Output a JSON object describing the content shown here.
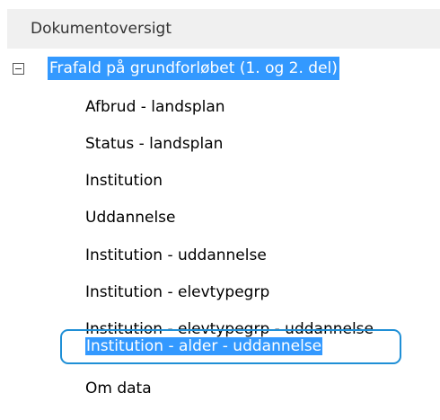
{
  "pane": {
    "title": "Dokumentoversigt"
  },
  "tree": {
    "root": {
      "label": "Frafald på grundforløbet (1. og 2. del)",
      "expanded": true,
      "selected": true
    },
    "children": [
      {
        "label": "Afbrud - landsplan"
      },
      {
        "label": "Status - landsplan"
      },
      {
        "label": "Institution"
      },
      {
        "label": "Uddannelse"
      },
      {
        "label": "Institution - uddannelse"
      },
      {
        "label": "Institution - elevtypegrp"
      },
      {
        "label": "Institution - elevtypegrp - uddannelse"
      },
      {
        "label": "Institution - alder - uddannelse",
        "selected": true
      },
      {
        "label": "Om data"
      }
    ]
  },
  "colors": {
    "selection": "#3399ff",
    "focus_ring": "#1f8fd6",
    "header_bg": "#f0f0f0"
  },
  "icons": {
    "toggle": "collapse-minus-icon"
  }
}
